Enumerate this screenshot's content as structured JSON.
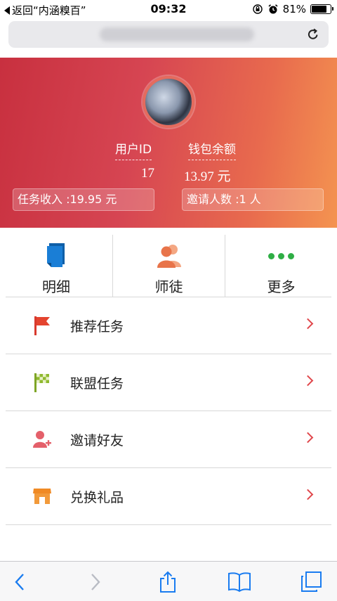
{
  "status_bar": {
    "back_app": "返回“内涵糗百”",
    "time": "09:32",
    "battery": "81%",
    "battery_level": 0.81
  },
  "header": {
    "user_id_label": "用户ID",
    "user_id_value": "17",
    "wallet_label": "钱包余额",
    "wallet_value": "13.97 元",
    "task_income": "任务收入 :19.95 元",
    "invited_count": "邀请人数 :1 人"
  },
  "grid": [
    {
      "label": "明细",
      "icon": "detail-icon"
    },
    {
      "label": "师徒",
      "icon": "mentor-icon"
    },
    {
      "label": "更多",
      "icon": "more-icon"
    }
  ],
  "menu": [
    {
      "label": "推荐任务",
      "icon": "red-flag-icon"
    },
    {
      "label": "联盟任务",
      "icon": "checkered-flag-icon"
    },
    {
      "label": "邀请好友",
      "icon": "add-user-icon"
    },
    {
      "label": "兑换礼品",
      "icon": "shop-icon"
    }
  ],
  "colors": {
    "header_start": "#c8303f",
    "header_end": "#f49450",
    "accent_red": "#e0474c",
    "more_green": "#2fae45",
    "ios_blue": "#1a7cf0"
  }
}
